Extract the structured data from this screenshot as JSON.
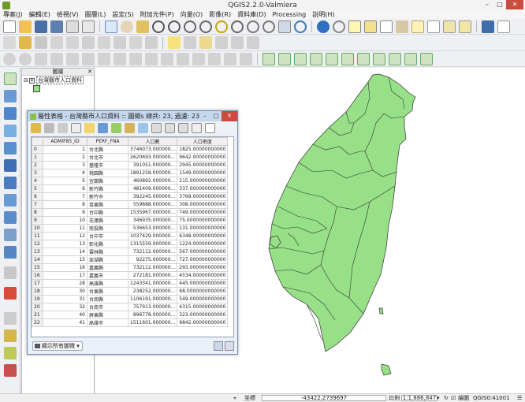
{
  "window": {
    "title": "QGIS2.2.0-Valmiera"
  },
  "menu": [
    "專案(J)",
    "編輯(E)",
    "檢視(V)",
    "圖層(L)",
    "設定(S)",
    "附加元件(P)",
    "向量(O)",
    "影像(R)",
    "資料庫(D)",
    "Processing",
    "說明(H)"
  ],
  "layers_panel": {
    "title": "圖層",
    "layer_name": "台灣縣市人口資料",
    "fill_color": "#97e087"
  },
  "attribute_table": {
    "title": "屬性表格 - 台灣縣市人口資料 :: 圖徵s 總共: 23, 過濾: 23,...",
    "columns": [
      "ADMIF85_ID",
      "PERF_FNA",
      "人口數",
      "人口密度"
    ],
    "rows": [
      [
        "0",
        "1",
        "台北縣",
        "3746073.000000...",
        "1825.00000000000"
      ],
      [
        "1",
        "2",
        "台北市",
        "2620693.000000...",
        "9642.00000000000"
      ],
      [
        "2",
        "3",
        "基隆市",
        "391051.000000...",
        "2945.00000000000"
      ],
      [
        "3",
        "4",
        "桃園縣",
        "1891258.000000...",
        "1549.00000000000"
      ],
      [
        "4",
        "5",
        "宜蘭縣",
        "460892.000000...",
        "215.000000000000"
      ],
      [
        "5",
        "6",
        "新竹縣",
        "481409.000000...",
        "337.000000000000"
      ],
      [
        "6",
        "7",
        "新竹市",
        "392245.000000...",
        "3768.00000000000"
      ],
      [
        "7",
        "8",
        "苗栗縣",
        "559888.000000...",
        "308.000000000000"
      ],
      [
        "8",
        "9",
        "台中縣",
        "1535967.000000...",
        "749.000000000000"
      ],
      [
        "9",
        "10",
        "花蓮縣",
        "346935.000000...",
        "75.0000000000000"
      ],
      [
        "10",
        "11",
        "南投縣",
        "536653.000000...",
        "131.000000000000"
      ],
      [
        "11",
        "12",
        "台中市",
        "1037429.000000...",
        "6348.00000000000"
      ],
      [
        "12",
        "13",
        "彰化縣",
        "1315559.000000...",
        "1224.00000000000"
      ],
      [
        "13",
        "14",
        "雲林縣",
        "732112.000000...",
        "567.000000000000"
      ],
      [
        "14",
        "15",
        "澎湖縣",
        "92275.000000...",
        "727.000000000000"
      ],
      [
        "15",
        "16",
        "嘉義縣",
        "732112.000000...",
        "293.000000000000"
      ],
      [
        "16",
        "17",
        "嘉義市",
        "272181.000000...",
        "4534.00000000000"
      ],
      [
        "17",
        "28",
        "高雄縣",
        "1243341.000000...",
        "445.000000000000"
      ],
      [
        "18",
        "30",
        "台東縣",
        "238252.000000...",
        "68.0000000000000"
      ],
      [
        "19",
        "31",
        "台南縣",
        "1106191.000000...",
        "549.000000000000"
      ],
      [
        "20",
        "32",
        "台南市",
        "757913.000000...",
        "4315.00000000000"
      ],
      [
        "21",
        "40",
        "屏東縣",
        "896778.000000...",
        "323.000000000000"
      ],
      [
        "22",
        "41",
        "高雄市",
        "1511601.000000...",
        "9842.00000000000"
      ]
    ],
    "show_all_label": "顯示所有圖徵"
  },
  "status": {
    "coord_label": "坐標",
    "coord_value": "-43422,2739697",
    "scale_label": "比例",
    "scale_value": "1:1,886,847",
    "render_label": "繪圖",
    "crs": "QGIS0:41001"
  }
}
